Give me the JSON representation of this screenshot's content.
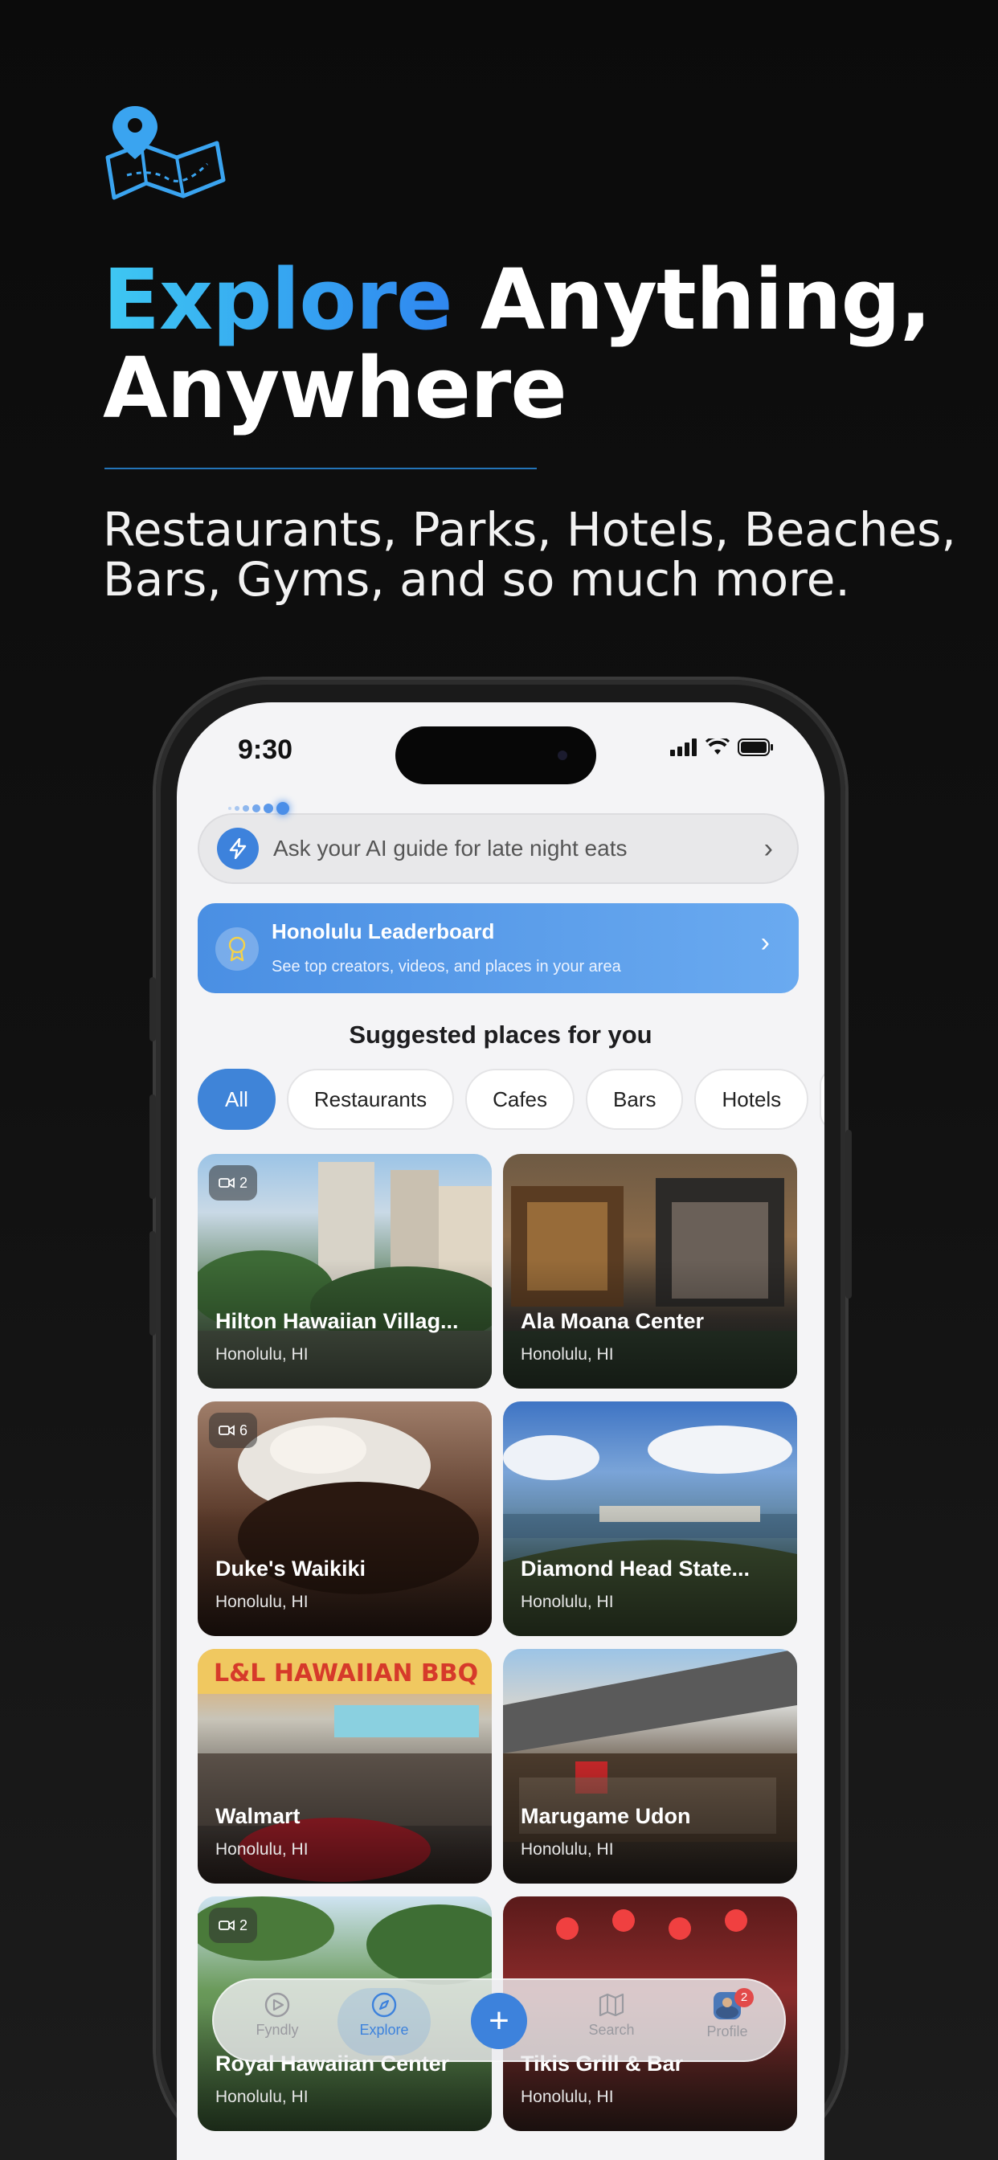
{
  "hero": {
    "icon": "map-pin-icon",
    "headline_accent": "Explore",
    "headline_rest_line1": " Anything,",
    "headline_line2": "Anywhere",
    "subline_line1": "Restaurants, Parks, Hotels, Beaches,",
    "subline_line2": "Bars, Gyms, and so much more.",
    "accent_colors": [
      "#3ec8f2",
      "#2f86f0"
    ]
  },
  "status": {
    "time": "9:30"
  },
  "ai_prompt": {
    "text": "Ask your AI guide for late night eats",
    "icon": "bolt-icon"
  },
  "leaderboard": {
    "title": "Honolulu Leaderboard",
    "subtitle": "See top creators, videos, and places in your area",
    "icon": "medal-icon"
  },
  "suggested": {
    "title": "Suggested places for you",
    "filters": [
      "All",
      "Restaurants",
      "Cafes",
      "Bars",
      "Hotels"
    ],
    "active_filter": "All"
  },
  "places": [
    {
      "name": "Hilton Hawaiian Villag...",
      "location": "Honolulu, HI",
      "videos": "2"
    },
    {
      "name": "Ala Moana Center",
      "location": "Honolulu, HI",
      "videos": ""
    },
    {
      "name": "Duke's Waikiki",
      "location": "Honolulu, HI",
      "videos": "6"
    },
    {
      "name": "Diamond Head State...",
      "location": "Honolulu, HI",
      "videos": ""
    },
    {
      "name": "Walmart",
      "location": "Honolulu, HI",
      "videos": ""
    },
    {
      "name": "Marugame Udon",
      "location": "Honolulu, HI",
      "videos": ""
    },
    {
      "name": "Royal Hawaiian Center",
      "location": "Honolulu, HI",
      "videos": "2"
    },
    {
      "name": "Tikis Grill & Bar",
      "location": "Honolulu, HI",
      "videos": ""
    }
  ],
  "tabbar": {
    "tabs": [
      {
        "label": "Fyndly",
        "icon": "play-circle-icon"
      },
      {
        "label": "Explore",
        "icon": "compass-icon"
      },
      {
        "label": "Search",
        "icon": "map-icon"
      },
      {
        "label": "Profile",
        "icon": "avatar"
      }
    ],
    "active": "Explore",
    "add_icon": "plus-icon",
    "profile_badge": "2"
  }
}
